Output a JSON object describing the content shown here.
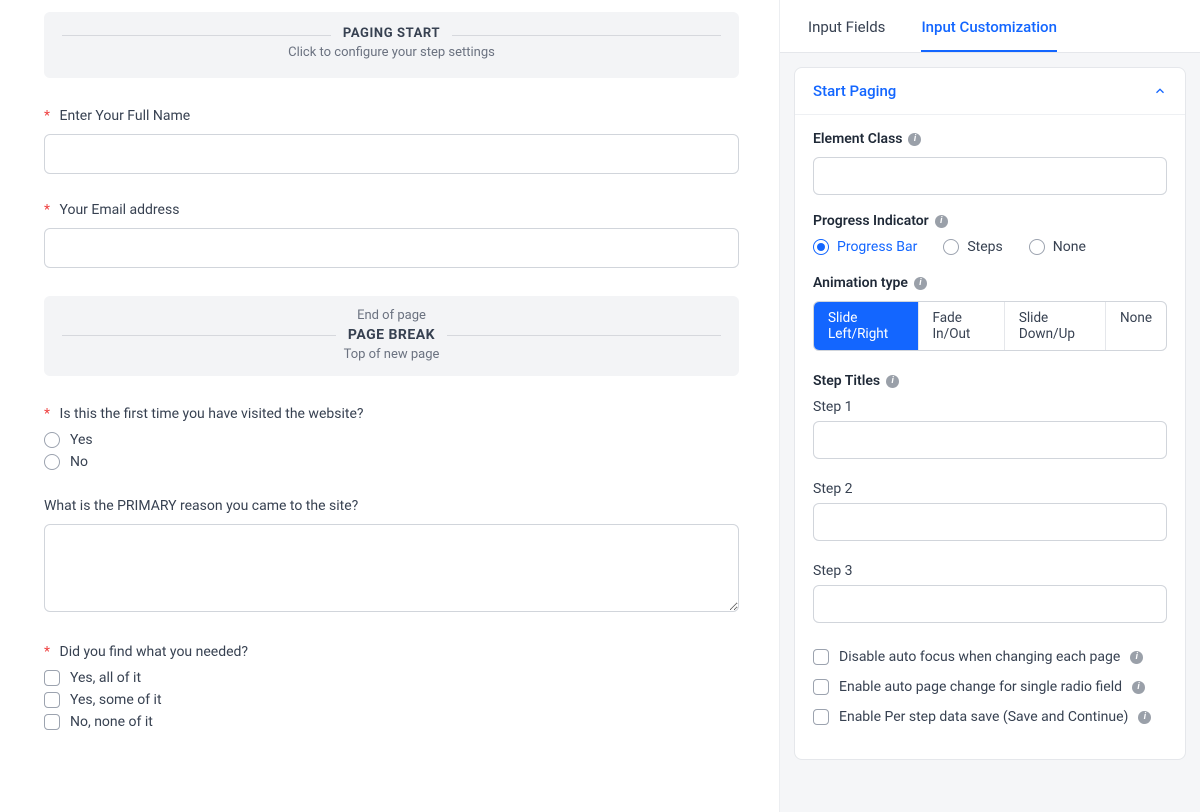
{
  "form": {
    "paging_start": {
      "title": "PAGING START",
      "subtitle": "Click to configure your step settings"
    },
    "fields": {
      "full_name": {
        "label": "Enter Your Full Name",
        "required": true
      },
      "email": {
        "label": "Your Email address",
        "required": true
      },
      "first_visit": {
        "label": "Is this the first time you have visited the website?",
        "required": true,
        "options": [
          "Yes",
          "No"
        ]
      },
      "primary_reason": {
        "label": "What is the PRIMARY reason you came to the site?",
        "required": false
      },
      "found_needed": {
        "label": "Did you find what you needed?",
        "required": true,
        "options": [
          "Yes, all of it",
          "Yes, some of it",
          "No, none of it"
        ]
      }
    },
    "page_break": {
      "top": "End of page",
      "mid": "PAGE BREAK",
      "bottom": "Top of new page"
    }
  },
  "panel": {
    "tabs": {
      "input_fields": "Input Fields",
      "input_customization": "Input Customization"
    },
    "section_title": "Start Paging",
    "element_class": {
      "label": "Element Class",
      "value": ""
    },
    "progress_indicator": {
      "label": "Progress Indicator",
      "options": {
        "bar": "Progress Bar",
        "steps": "Steps",
        "none": "None"
      },
      "selected": "bar"
    },
    "animation": {
      "label": "Animation type",
      "options": {
        "slide_lr": "Slide Left/Right",
        "fade": "Fade In/Out",
        "slide_du": "Slide Down/Up",
        "none": "None"
      },
      "selected": "slide_lr"
    },
    "step_titles": {
      "label": "Step Titles",
      "steps": {
        "s1": "Step 1",
        "s2": "Step 2",
        "s3": "Step 3"
      }
    },
    "checkboxes": {
      "disable_autofocus": "Disable auto focus when changing each page",
      "auto_page_change": "Enable auto page change for single radio field",
      "per_step_save": "Enable Per step data save (Save and Continue)"
    }
  }
}
